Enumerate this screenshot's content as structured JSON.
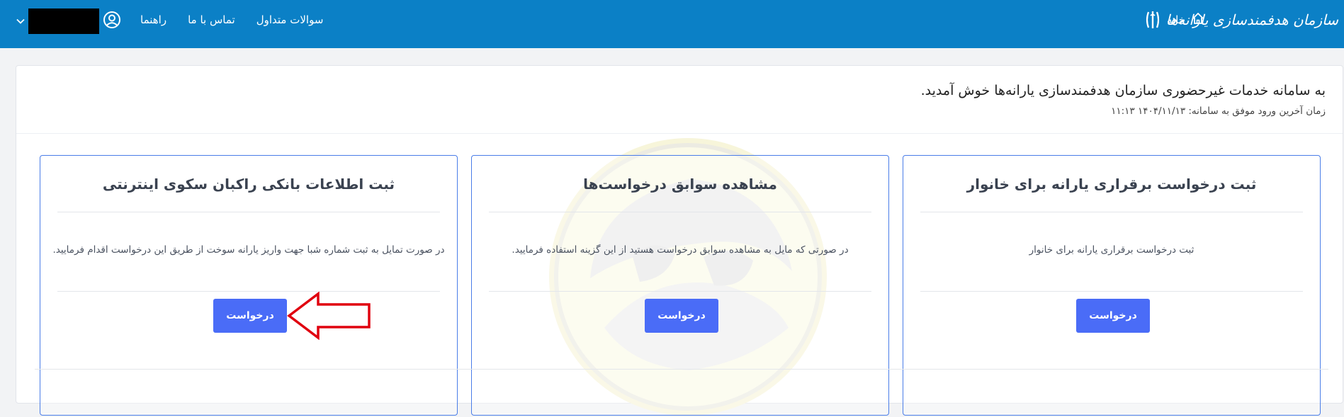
{
  "header": {
    "brand_text": "سازمان هدفمندسازی یارانه‌ها",
    "home_label": "خانه",
    "nav": {
      "faq": "سوالات متداول",
      "contact": "تماس با ما",
      "guide": "راهنما"
    }
  },
  "main": {
    "welcome": "به سامانه خدمات غیرحضوری سازمان هدفمندسازی یارانه‌ها خوش آمدید.",
    "last_login": "زمان آخرین ورود موفق به سامانه: ۱۴۰۴/۱۱/۱۳ ۱۱:۱۳",
    "cards": [
      {
        "title": "ثبت درخواست برقراری یارانه برای خانوار",
        "description": "ثبت درخواست برقراری یارانه برای خانوار",
        "button": "درخواست"
      },
      {
        "title": "مشاهده سوابق درخواست‌ها",
        "description": "در صورتی که مایل به مشاهده سوابق درخواست هستید از این گزینه استفاده فرمایید.",
        "button": "درخواست"
      },
      {
        "title": "ثبت اطلاعات بانکی راکبان سکوی اینترنتی",
        "description": "در صورت تمایل به ثبت شماره شبا جهت واریز یارانه سوخت از طریق این درخواست اقدام فرمایید.",
        "button": "درخواست"
      }
    ]
  },
  "colors": {
    "header_bg": "#0b80c6",
    "button_bg": "#4a6cf7",
    "card_border": "#4a7de8",
    "annotation_arrow": "#e0000f"
  },
  "icons": {
    "brand_logo": "emblem-icon",
    "home": "home-icon",
    "user": "user-circle-icon",
    "chevron": "chevron-down-icon",
    "annotation": "arrow-pointer-icon"
  }
}
